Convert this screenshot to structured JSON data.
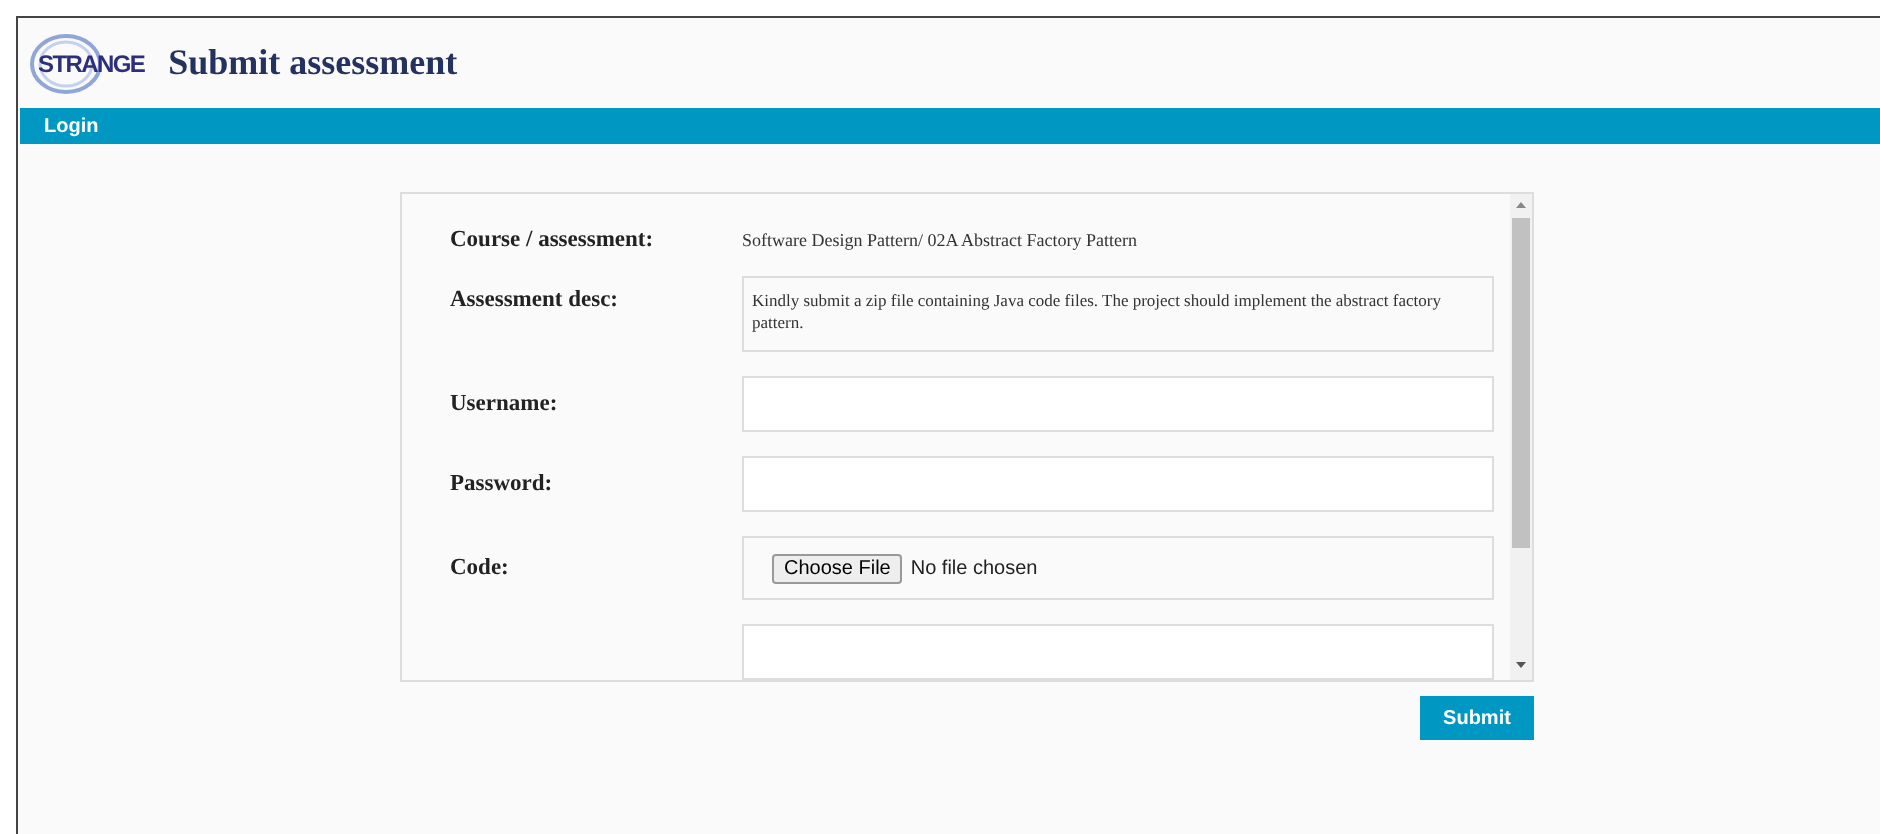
{
  "header": {
    "logo": "STRANGE",
    "title": "Submit assessment"
  },
  "nav": {
    "items": [
      {
        "label": "Login"
      }
    ]
  },
  "form": {
    "rows": [
      {
        "kind": "text",
        "label": "Course / assessment:",
        "value": "Software Design Pattern/ 02A Abstract Factory Pattern"
      },
      {
        "kind": "description",
        "label": "Assessment desc:",
        "value": "Kindly submit a zip file containing Java code files. The project should implement the abstract factory pattern."
      },
      {
        "kind": "input",
        "label": "Username:"
      },
      {
        "kind": "password",
        "label": "Password:"
      },
      {
        "kind": "file",
        "label": "Code:",
        "button": "Choose File",
        "status": "No file chosen"
      },
      {
        "kind": "input"
      }
    ],
    "submit": "Submit"
  }
}
